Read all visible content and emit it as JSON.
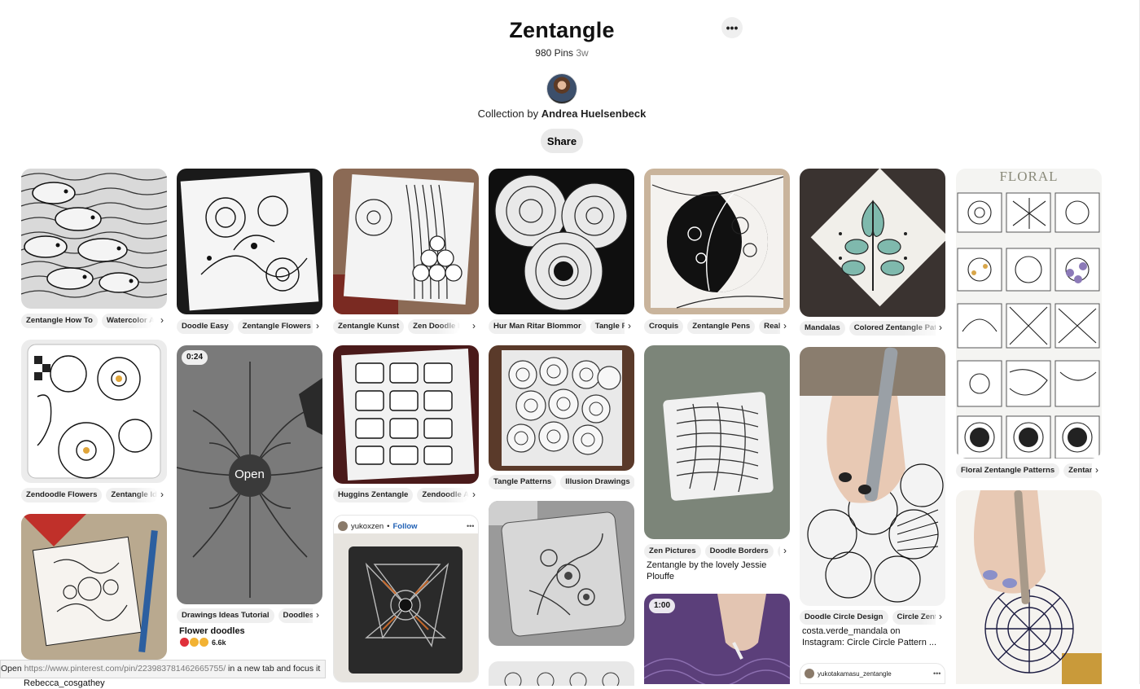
{
  "board": {
    "title": "Zentangle",
    "pin_count": "980 Pins",
    "updated": "3w",
    "collection_prefix": "Collection by",
    "owner": "Andrea Huelsenbeck",
    "share_label": "Share",
    "more_label": "•••"
  },
  "pins": [
    {
      "tags": [
        "Zentangle How To",
        "Watercolor And"
      ],
      "title": ""
    },
    {
      "tags": [
        "Doodle Easy",
        "Zentangle Flowers"
      ],
      "title": ""
    },
    {
      "tags": [
        "Zentangle Kunst",
        "Zen Doodle Patterns"
      ],
      "title": ""
    },
    {
      "tags": [
        "Hur Man Ritar Blommor",
        "Tangle Patterns"
      ],
      "title": ""
    },
    {
      "tags": [
        "Croquis",
        "Zentangle Pens",
        "Really"
      ],
      "title": ""
    },
    {
      "tags": [
        "Mandalas",
        "Colored Zentangle Patterns"
      ],
      "title": ""
    },
    {
      "tags": [
        "Floral Zentangle Patterns",
        "Zentangle"
      ],
      "title": "",
      "header_text": "FLORAL"
    },
    {
      "tags": [
        "Zendoodle Flowers",
        "Zentangle Ideas"
      ],
      "title": ""
    },
    {
      "tags": [
        "Drawings Ideas Tutorial",
        "Doodles Easy"
      ],
      "title": "Flower doodles",
      "duration": "0:24",
      "open_label": "Open",
      "reactions": "6.6k"
    },
    {
      "tags": [
        "Huggins Zentangle",
        "Zendoodle Art"
      ],
      "title": ""
    },
    {
      "tags": [
        "Tangle Patterns",
        "Illusion Drawings"
      ],
      "title": ""
    },
    {
      "tags": [
        "Zen Pictures",
        "Doodle Borders",
        "Cool"
      ],
      "title": "Zentangle by the lovely Jessie Plouffe"
    },
    {
      "tags": [
        "Doodle Circle Design",
        "Circle Zentangle"
      ],
      "title": "costa.verde_mandala on Instagram: Circle Circle Pattern ..."
    },
    {
      "tags": [],
      "title": "",
      "user": "yukoxzen",
      "follow": "Follow"
    },
    {
      "tags": [],
      "title": "",
      "duration": "1:00"
    },
    {
      "tags": [],
      "title": "",
      "user": "yukotakamasu_zentangle"
    }
  ],
  "partial_caption": "Rebecca_cosgathey",
  "status_bar": {
    "prefix": "Open",
    "url": "https://www.pinterest.com/pin/223983781462665755/",
    "suffix": "in a new tab and focus it"
  },
  "icons": [
    "more-dots-icon",
    "chevron-right-icon",
    "heart-reaction-icon"
  ]
}
